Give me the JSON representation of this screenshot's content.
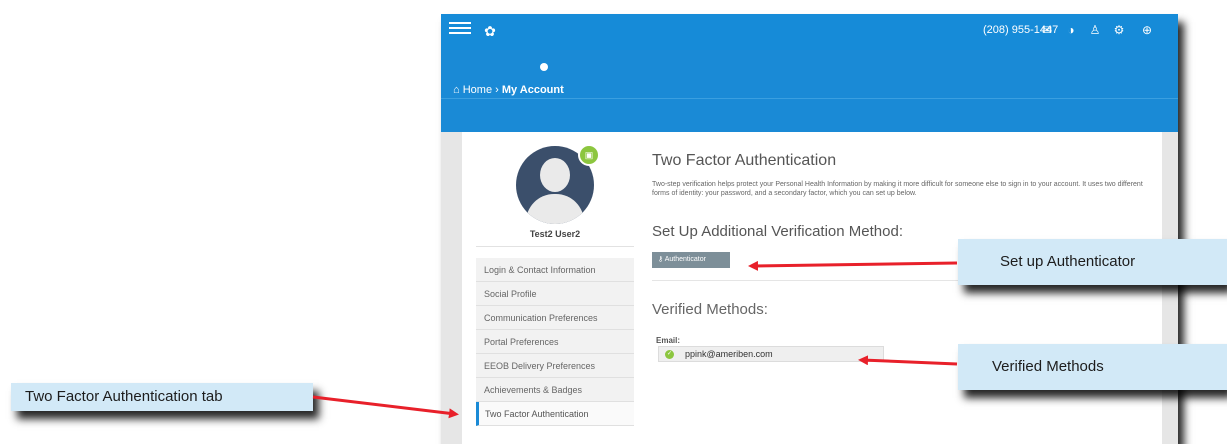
{
  "header": {
    "phone": "(208) 955-1447"
  },
  "breadcrumb": {
    "home": "Home",
    "separator": "›",
    "current": "My Account"
  },
  "profile": {
    "username": "Test2 User2"
  },
  "menu": {
    "items": [
      {
        "label": "Login & Contact Information"
      },
      {
        "label": "Social Profile"
      },
      {
        "label": "Communication Preferences"
      },
      {
        "label": "Portal Preferences"
      },
      {
        "label": "EEOB Delivery Preferences"
      },
      {
        "label": "Achievements & Badges"
      },
      {
        "label": "Two Factor Authentication"
      }
    ]
  },
  "content": {
    "title": "Two Factor Authentication",
    "description": "Two-step verification helps protect your Personal Health Information by making it more difficult for someone else to sign in to your account. It uses two different forms of identity: your password, and a secondary factor, which you can set up below.",
    "setup_title": "Set Up Additional Verification Method:",
    "authenticator_label": "Authenticator",
    "verified_title": "Verified Methods:",
    "email_label": "Email:",
    "email_value": "ppink@ameriben.com"
  },
  "callouts": {
    "setup": "Set up Authenticator",
    "verified": "Verified Methods",
    "tab": "Two Factor Authentication tab"
  },
  "colors": {
    "header_blue": "#1a8ad6",
    "callout_bg": "#d2e9f7",
    "arrow_red": "#e8202a",
    "success_green": "#8cc63f"
  }
}
